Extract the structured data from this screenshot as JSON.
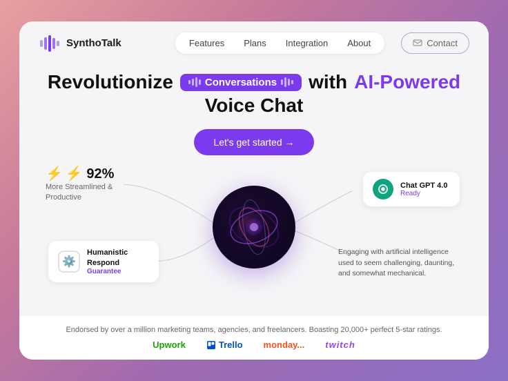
{
  "app": {
    "name": "SynthoTalk"
  },
  "navbar": {
    "logo_text": "SynthoTalk",
    "links": [
      {
        "label": "Features",
        "id": "features"
      },
      {
        "label": "Plans",
        "id": "plans"
      },
      {
        "label": "Integration",
        "id": "integration"
      },
      {
        "label": "About",
        "id": "about"
      }
    ],
    "contact_label": "Contact"
  },
  "hero": {
    "title_left": "Revolutionize",
    "badge_text": "Conversations",
    "title_right": "with",
    "title_ai": "AI-Powered",
    "title_sub": "Voice Chat",
    "cta_label": "Let's get started →"
  },
  "stats": {
    "percent": "⚡ 92%",
    "label_line1": "More Streamlined &",
    "label_line2": "Productive"
  },
  "humanistic_card": {
    "title": "Humanistic Respond",
    "subtitle": "Guarantee"
  },
  "chatgpt_card": {
    "title": "Chat GPT 4.0",
    "status": "Ready"
  },
  "right_desc": "Engaging with artificial intelligence used to seem challenging, daunting, and somewhat mechanical.",
  "endorsed": {
    "text": "Endorsed by over a million marketing teams, agencies, and freelancers. Boasting 20,000+ perfect 5-star ratings.",
    "logos": [
      {
        "label": "Upwork",
        "class": "logo-upwork"
      },
      {
        "label": "⊟ Trello",
        "class": "logo-trello"
      },
      {
        "label": "monday...",
        "class": "logo-monday"
      },
      {
        "label": "twitch",
        "class": "logo-twitch"
      }
    ]
  },
  "colors": {
    "accent": "#7c3aed",
    "green": "#10a37f"
  }
}
